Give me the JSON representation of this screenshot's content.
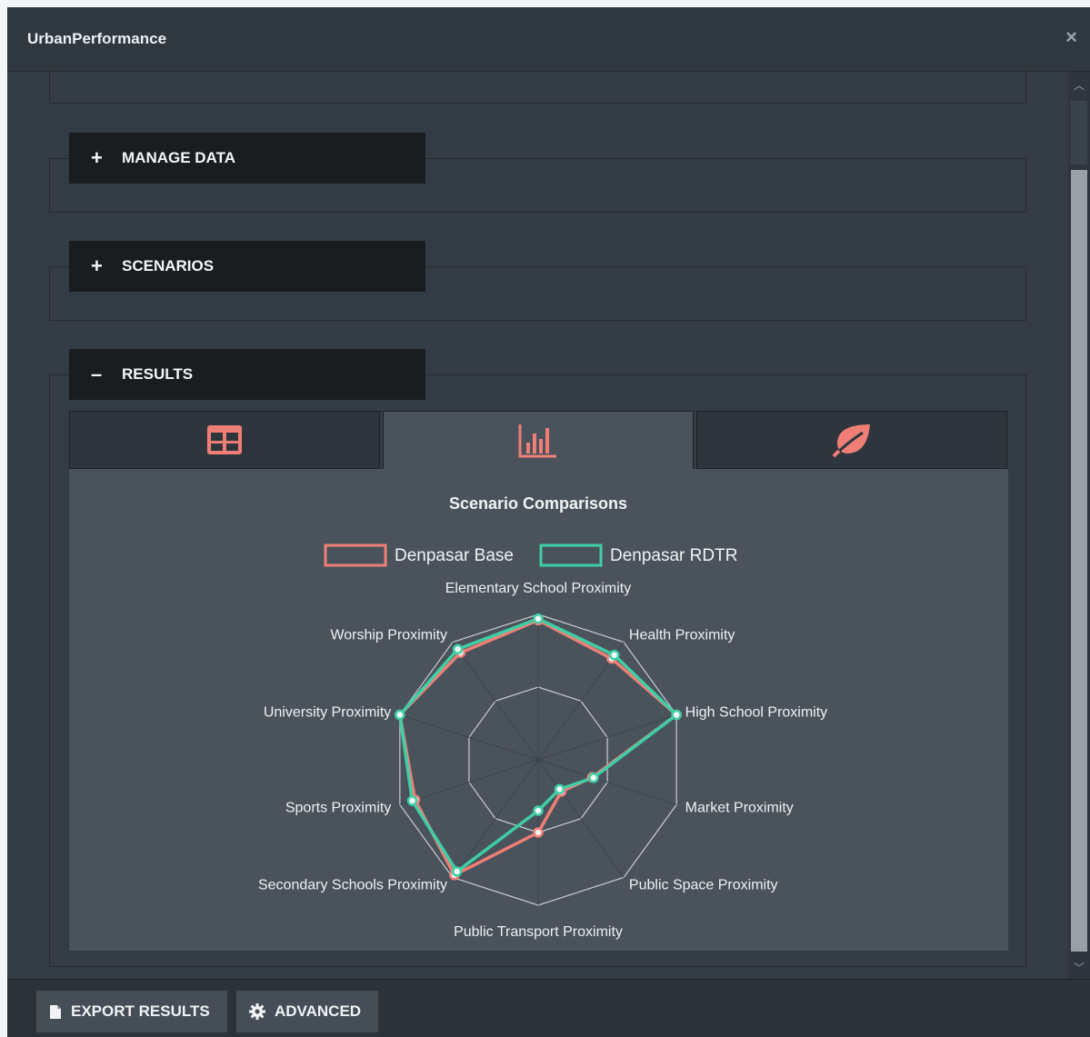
{
  "window": {
    "title": "UrbanPerformance",
    "close_symbol": "×"
  },
  "sections": [
    {
      "label": "MANAGE DATA",
      "symbol": "+"
    },
    {
      "label": "SCENARIOS",
      "symbol": "+"
    },
    {
      "label": "RESULTS",
      "symbol": "–"
    }
  ],
  "tabs": [
    {
      "icon": "table-icon",
      "active": false
    },
    {
      "icon": "bar-chart-icon",
      "active": true
    },
    {
      "icon": "leaf-icon",
      "active": false
    }
  ],
  "colors": {
    "accent": "#ef7f76",
    "series_base": "#ef7f76",
    "series_rdtr": "#3fcfa6"
  },
  "footer": {
    "export_label": "EXPORT RESULTS",
    "advanced_label": "ADVANCED"
  },
  "chart_data": {
    "type": "radar",
    "title": "Scenario Comparisons",
    "axes": [
      "Elementary School Proximity",
      "Health Proximity",
      "High School Proximity",
      "Market Proximity",
      "Public Space Proximity",
      "Public Transport Proximity",
      "Secondary Schools Proximity",
      "Sports Proximity",
      "University Proximity",
      "Worship Proximity"
    ],
    "series": [
      {
        "name": "Denpasar Base",
        "values": [
          0.96,
          0.86,
          1.0,
          0.39,
          0.27,
          0.5,
          0.98,
          0.89,
          1.0,
          0.91
        ]
      },
      {
        "name": "Denpasar RDTR",
        "values": [
          0.97,
          0.89,
          1.0,
          0.4,
          0.25,
          0.35,
          0.95,
          0.91,
          1.0,
          0.94
        ]
      }
    ],
    "rlim": [
      0,
      1
    ],
    "grid_levels": 2,
    "legend": "top"
  }
}
